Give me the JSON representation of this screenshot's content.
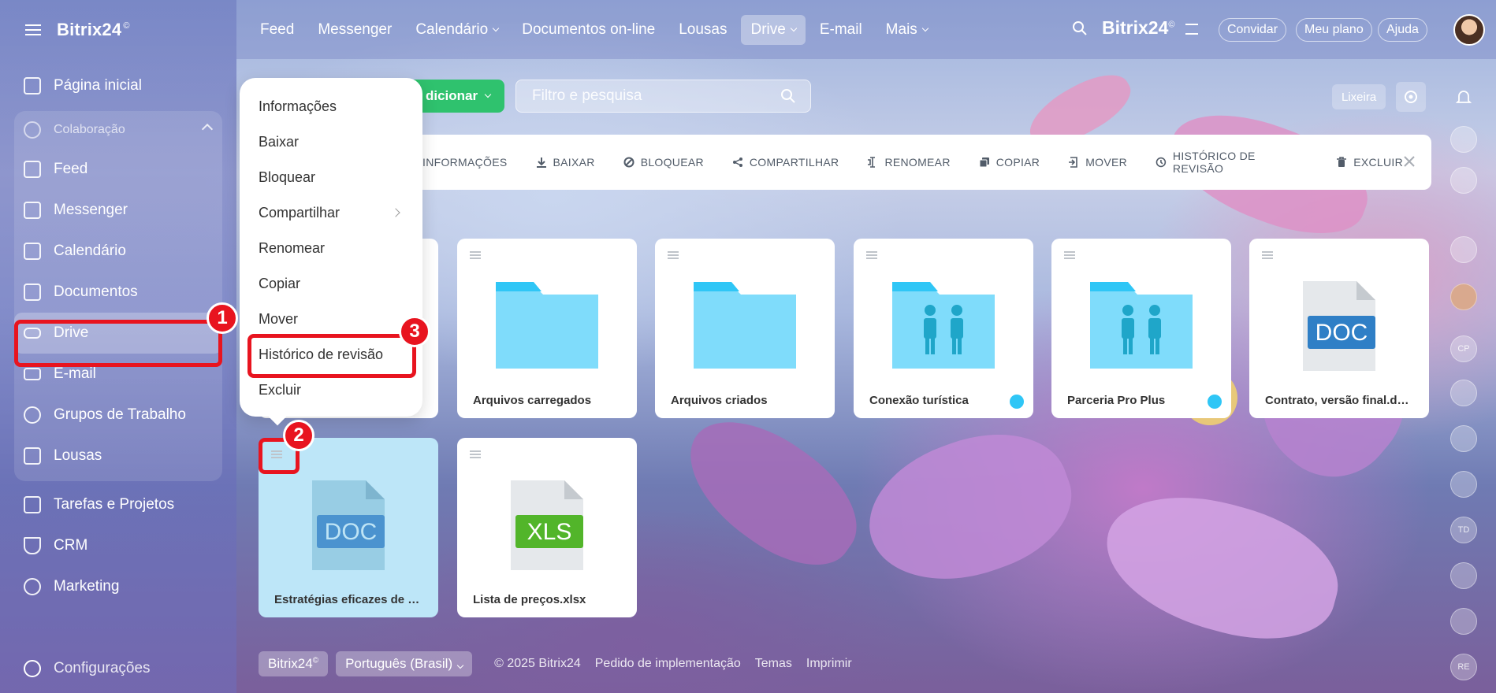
{
  "sidebar": {
    "logo": "Bitrix24",
    "logo_mark": "©",
    "home": "Página inicial",
    "group_label": "Colaboração",
    "group_items": [
      "Feed",
      "Messenger",
      "Calendário",
      "Documentos",
      "Drive",
      "E-mail",
      "Grupos de Trabalho",
      "Lousas"
    ],
    "items_after": [
      "Tarefas e Projetos",
      "CRM",
      "Marketing"
    ],
    "settings": "Configurações"
  },
  "topbar": {
    "nav": [
      "Feed",
      "Messenger",
      "Calendário",
      "Documentos on-line",
      "Lousas",
      "Drive",
      "E-mail",
      "Mais"
    ],
    "brand": "Bitrix24",
    "invite": "Convidar",
    "plan": "Meu plano",
    "help": "Ajuda"
  },
  "toolbar": {
    "add_label": "dicionar",
    "search_placeholder": "Filtro e pesquisa",
    "trash": "Lixeira"
  },
  "actionbar": {
    "actions": [
      "INFORMAÇÕES",
      "BAIXAR",
      "BLOQUEAR",
      "COMPARTILHAR",
      "RENOMEAR",
      "COPIAR",
      "MOVER",
      "HISTÓRICO DE REVISÃO",
      "EXCLUIR"
    ]
  },
  "context_menu": {
    "items": [
      "Informações",
      "Baixar",
      "Bloquear",
      "Compartilhar",
      "Renomear",
      "Copiar",
      "Mover",
      "Histórico de revisão",
      "Excluir"
    ]
  },
  "tiles": [
    {
      "name": "Arquivos carregados",
      "kind": "folder"
    },
    {
      "name": "Arquivos criados",
      "kind": "folder"
    },
    {
      "name": "Conexão turística",
      "kind": "shared-folder"
    },
    {
      "name": "Parceria Pro Plus",
      "kind": "shared-folder"
    },
    {
      "name": "Contrato, versão final.docx",
      "kind": "doc",
      "label": "DOC"
    },
    {
      "name": "Estratégias eficazes de ma...",
      "kind": "doc",
      "label": "DOC"
    },
    {
      "name": "Lista de preços.xlsx",
      "kind": "xls",
      "label": "XLS"
    }
  ],
  "annotations": [
    "1",
    "2",
    "3"
  ],
  "rail_initials": [
    "CP",
    "TD",
    "RE"
  ],
  "footer": {
    "brand": "Bitrix24",
    "language": "Português (Brasil)",
    "copyright": "© 2025 Bitrix24",
    "links": [
      "Pedido de implementação",
      "Temas",
      "Imprimir"
    ]
  },
  "colors": {
    "accent_green": "#2fc26e",
    "annotation_red": "#e8141f",
    "folder_blue": "#7fdcfb",
    "doc_blue": "#2f7fc6",
    "xls_green": "#52b52a"
  }
}
